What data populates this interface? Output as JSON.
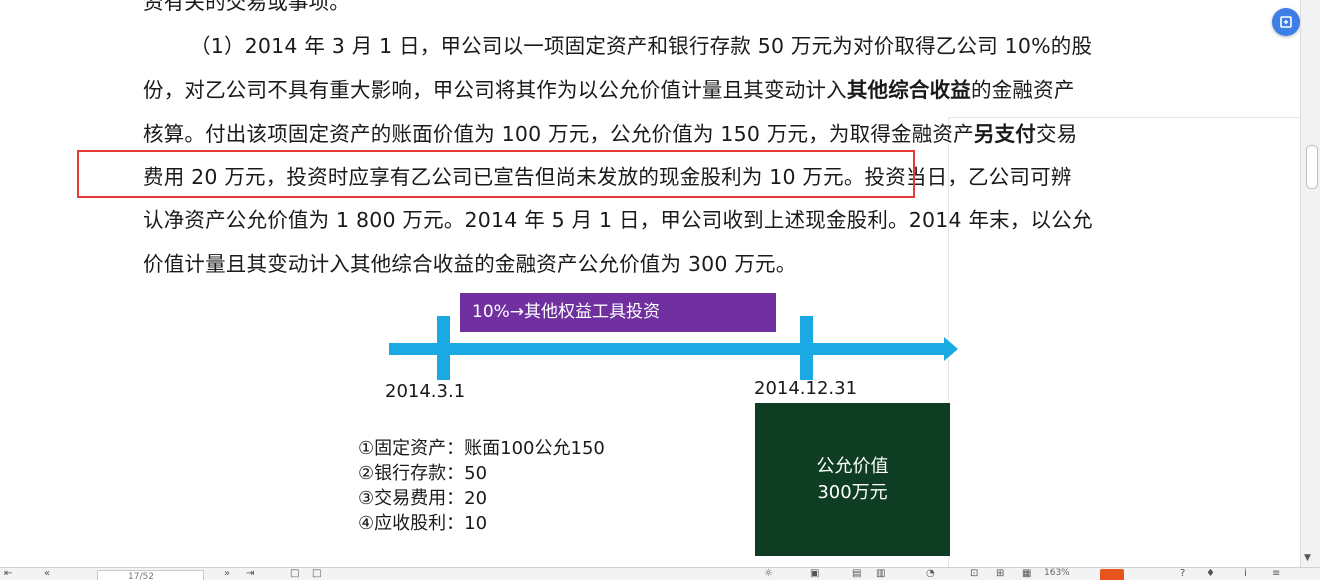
{
  "document": {
    "line0": "资有关的交易或事项。",
    "line1": "（1）2014 年 3 月 1 日，甲公司以一项固定资产和银行存款 50 万元为对价取得乙公司 10%的股",
    "line2_pre": "份，对乙公司不具有重大影响，甲公司将其作为以公允价值计量且其变动计入",
    "line2_bold": "其他综合收益",
    "line2_post": "的金融资产",
    "line3_pre": "核算。付出该项固定资产的账面价值为 100 万元，公允价值为 150 万元，为取得金融资产",
    "line3_bold": "另支付",
    "line3_post": "交易",
    "line4": "费用 20 万元，投资时应享有乙公司已宣告但尚未发放的现金股利为 10 万元。投资当日，乙公司可辨",
    "line5": "认净资产公允价值为 1 800 万元。2014 年 5 月 1 日，甲公司收到上述现金股利。2014 年末，以公允",
    "line6": "价值计量且其变动计入其他综合收益的金融资产公允价值为 300 万元。"
  },
  "diagram": {
    "banner": "10%→其他权益工具投资",
    "date_start": "2014.3.1",
    "date_end": "2014.12.31",
    "fair_value_line1": "公允价值",
    "fair_value_line2": "300万元",
    "items": [
      "①固定资产：账面100公允150",
      "②银行存款：50",
      "③交易费用：20",
      "④应收股利：10"
    ]
  },
  "statusbar": {
    "page_indicator": "17/52",
    "zoom": "163%"
  },
  "colors": {
    "highlight_border": "#e53935",
    "timeline": "#1aa9e3",
    "banner_bg": "#7030a0",
    "fair_value_bg": "#0e3d24",
    "float_button": "#3d7fe6"
  },
  "icons": {
    "float_button": "convert-icon",
    "scroll_down": "triangle-down-icon"
  }
}
